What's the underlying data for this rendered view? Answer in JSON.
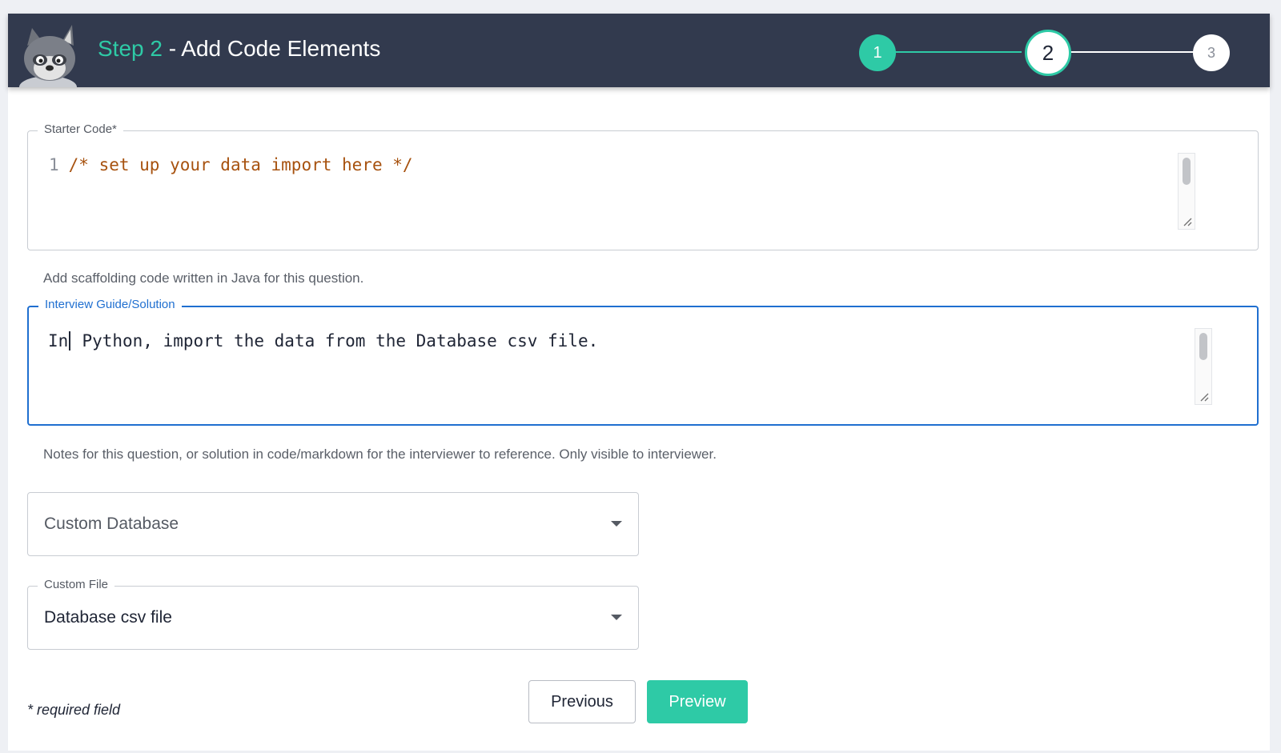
{
  "header": {
    "step_label": "Step 2",
    "title_rest": " - Add Code Elements",
    "stepper": {
      "steps": [
        "1",
        "2",
        "3"
      ],
      "current_step": 2
    }
  },
  "starter_code": {
    "legend": "Starter Code*",
    "line_number": "1",
    "code": "/* set up your data import here */",
    "helper": "Add scaffolding code written in Java for this question."
  },
  "guide": {
    "legend": "Interview Guide/Solution",
    "text_before_caret": "In",
    "text_after_caret": " Python, import the data from the Database csv file.",
    "helper": "Notes for this question, or solution in code/markdown for the interviewer to reference. Only visible to interviewer."
  },
  "database_select": {
    "value": "Custom Database"
  },
  "file_select": {
    "legend": "Custom File",
    "value": "Database csv file"
  },
  "footer": {
    "required_note": "* required field",
    "previous_label": "Previous",
    "preview_label": "Preview"
  },
  "colors": {
    "accent": "#2ecaa6",
    "header_bg": "#323a4e",
    "focus_blue": "#1f6fd0"
  }
}
